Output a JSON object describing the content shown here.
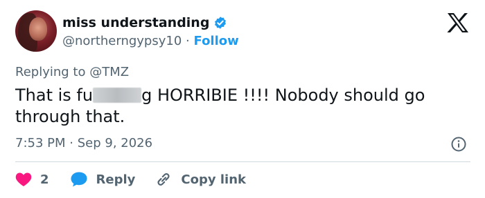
{
  "author": {
    "name": "miss understanding",
    "handle": "@northerngypsy10",
    "separator": "·",
    "follow_label": "Follow"
  },
  "tweet": {
    "replying_to_prefix": "Replying to",
    "replying_to_handle": "@TMZ",
    "text_before": "That is fu",
    "text_after": "g HORRIBIE !!!! Nobody should go through that.",
    "time": "7:53 PM",
    "date_separator": "·",
    "date": "Sep 9, 2026"
  },
  "actions": {
    "like_count": "2",
    "reply_label": "Reply",
    "copy_label": "Copy link"
  },
  "colors": {
    "accent": "#1d9bf0",
    "like": "#f91880",
    "muted": "#536471",
    "text": "#0f1419"
  },
  "icons": [
    "verified-badge-icon",
    "x-logo-icon",
    "info-icon",
    "heart-icon",
    "reply-bubble-icon",
    "link-icon"
  ]
}
